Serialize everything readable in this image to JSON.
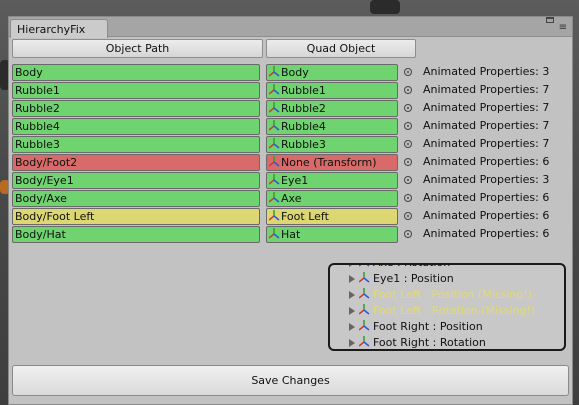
{
  "window": {
    "tab_title": "HierarchyFix"
  },
  "headers": {
    "object_path": "Object Path",
    "quad_object": "Quad Object"
  },
  "rows": [
    {
      "path": "Body",
      "object": "Body",
      "properties": "Animated Properties: 3",
      "status": "ok"
    },
    {
      "path": "Rubble1",
      "object": "Rubble1",
      "properties": "Animated Properties: 7",
      "status": "ok"
    },
    {
      "path": "Rubble2",
      "object": "Rubble2",
      "properties": "Animated Properties: 7",
      "status": "ok"
    },
    {
      "path": "Rubble4",
      "object": "Rubble4",
      "properties": "Animated Properties: 7",
      "status": "ok"
    },
    {
      "path": "Rubble3",
      "object": "Rubble3",
      "properties": "Animated Properties: 7",
      "status": "ok"
    },
    {
      "path": "Body/Foot2",
      "object": "None (Transform)",
      "properties": "Animated Properties: 6",
      "status": "missing"
    },
    {
      "path": "Body/Eye1",
      "object": "Eye1",
      "properties": "Animated Properties: 3",
      "status": "ok"
    },
    {
      "path": "Body/Axe",
      "object": "Axe",
      "properties": "Animated Properties: 6",
      "status": "ok"
    },
    {
      "path": "Body/Foot Left",
      "object": "Foot Left",
      "properties": "Animated Properties: 6",
      "status": "warning"
    },
    {
      "path": "Body/Hat",
      "object": "Hat",
      "properties": "Animated Properties: 6",
      "status": "ok"
    }
  ],
  "popup": {
    "items": [
      {
        "label": "Axe : Rotation",
        "missing": false
      },
      {
        "label": "Eye1 : Position",
        "missing": false
      },
      {
        "label": "Foot Left : Position (Missing!)",
        "missing": true
      },
      {
        "label": "Foot Left : Rotation (Missing!)",
        "missing": true
      },
      {
        "label": "Foot Right : Position",
        "missing": false
      },
      {
        "label": "Foot Right : Rotation",
        "missing": false
      }
    ]
  },
  "save_button": {
    "label": "Save Changes"
  },
  "colors": {
    "ok": "#6fd36f",
    "missing": "#d96a6a",
    "warning": "#dcd673",
    "missing_text": "#f5e93a"
  },
  "icons": {
    "transform": "transform-axes-icon",
    "target": "object-picker-icon",
    "expand": "expand-arrow-icon"
  }
}
